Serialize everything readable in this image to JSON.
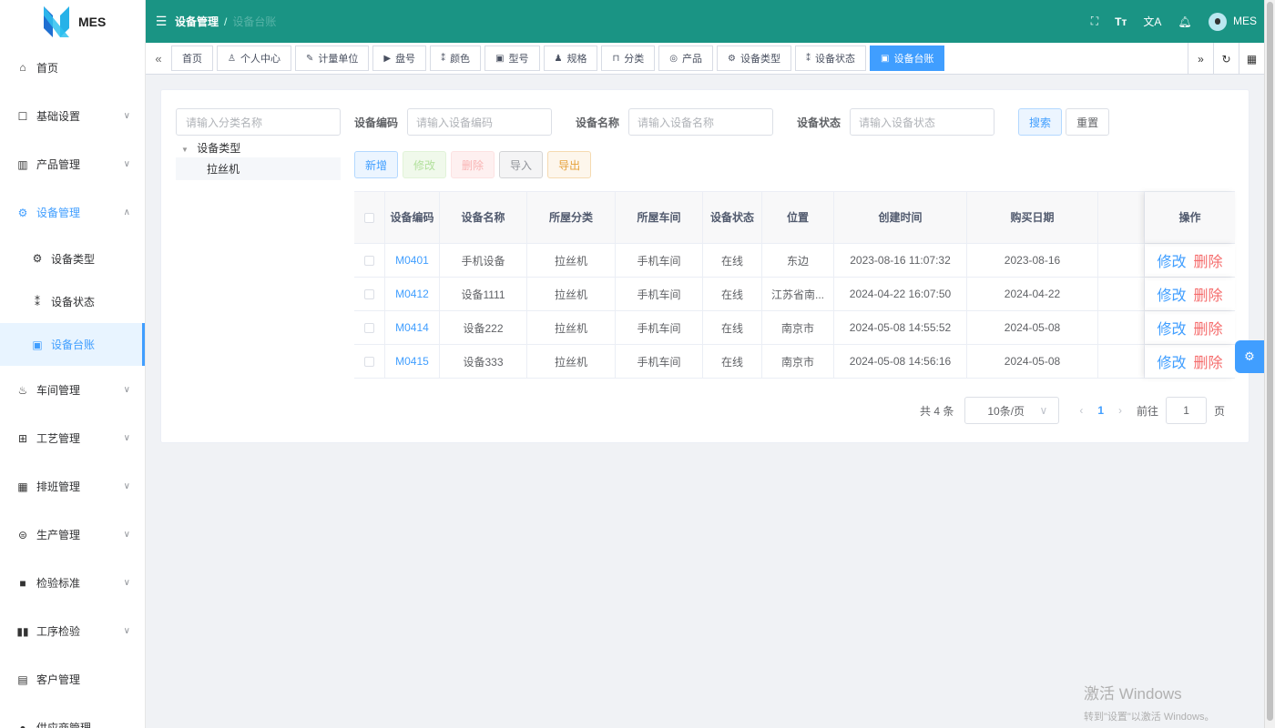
{
  "app": {
    "name": "MES"
  },
  "header": {
    "crumb_parent": "设备管理",
    "crumb_separator": "/",
    "crumb_current": "设备台账",
    "user": "MES"
  },
  "sidebar": {
    "items": [
      {
        "label": "首页",
        "icon": "home-icon"
      },
      {
        "label": "基础设置",
        "icon": "settings-icon"
      },
      {
        "label": "产品管理",
        "icon": "chart-icon"
      },
      {
        "label": "设备管理",
        "icon": "gear-icon"
      },
      {
        "label": "车间管理",
        "icon": "workshop-icon"
      },
      {
        "label": "工艺管理",
        "icon": "process-icon"
      },
      {
        "label": "排班管理",
        "icon": "calendar-icon"
      },
      {
        "label": "生产管理",
        "icon": "database-icon"
      },
      {
        "label": "检验标准",
        "icon": "monitor-icon"
      },
      {
        "label": "工序检验",
        "icon": "book-icon"
      },
      {
        "label": "客户管理",
        "icon": "contact-icon"
      },
      {
        "label": "供应商管理",
        "icon": "user-icon"
      }
    ],
    "sub_items": [
      {
        "label": "设备类型"
      },
      {
        "label": "设备状态"
      },
      {
        "label": "设备台账"
      }
    ]
  },
  "tags": [
    "首页",
    "个人中心",
    "计量单位",
    "盘号",
    "颜色",
    "型号",
    "规格",
    "分类",
    "产品",
    "设备类型",
    "设备状态",
    "设备台账"
  ],
  "tree": {
    "placeholder": "请输入分类名称",
    "root": "设备类型",
    "child": "拉丝机"
  },
  "search": {
    "code_label": "设备编码",
    "code_placeholder": "请输入设备编码",
    "name_label": "设备名称",
    "name_placeholder": "请输入设备名称",
    "status_label": "设备状态",
    "status_placeholder": "请输入设备状态",
    "search_btn": "搜索",
    "reset_btn": "重置"
  },
  "toolbar": {
    "add": "新增",
    "edit": "修改",
    "delete": "删除",
    "import": "导入",
    "export": "导出"
  },
  "table": {
    "headers": [
      "设备编码",
      "设备名称",
      "所屋分类",
      "所屋车间",
      "设备状态",
      "位置",
      "创建时间",
      "购买日期",
      "",
      "操作"
    ],
    "rows": [
      {
        "code": "M0401",
        "name": "手机设备",
        "category": "拉丝机",
        "workshop": "手机车间",
        "status": "在线",
        "location": "东边",
        "created": "2023-08-16 11:07:32",
        "purchase": "2023-08-16"
      },
      {
        "code": "M0412",
        "name": "设备1111",
        "category": "拉丝机",
        "workshop": "手机车间",
        "status": "在线",
        "location": "江苏省南...",
        "created": "2024-04-22 16:07:50",
        "purchase": "2024-04-22"
      },
      {
        "code": "M0414",
        "name": "设备222",
        "category": "拉丝机",
        "workshop": "手机车间",
        "status": "在线",
        "location": "南京市",
        "created": "2024-05-08 14:55:52",
        "purchase": "2024-05-08"
      },
      {
        "code": "M0415",
        "name": "设备333",
        "category": "拉丝机",
        "workshop": "手机车间",
        "status": "在线",
        "location": "南京市",
        "created": "2024-05-08 14:56:16",
        "purchase": "2024-05-08"
      }
    ],
    "op_edit": "修改",
    "op_delete": "删除"
  },
  "pager": {
    "total": "共 4 条",
    "page_size": "10条/页",
    "current": "1",
    "goto_label": "前往",
    "goto_value": "1",
    "page_suffix": "页"
  },
  "watermark": {
    "line1": "激活 Windows",
    "line2": "转到\"设置\"以激活 Windows。"
  },
  "colors": {
    "header_bg": "#1a9484",
    "primary": "#409eff",
    "danger": "#f56c6c"
  }
}
